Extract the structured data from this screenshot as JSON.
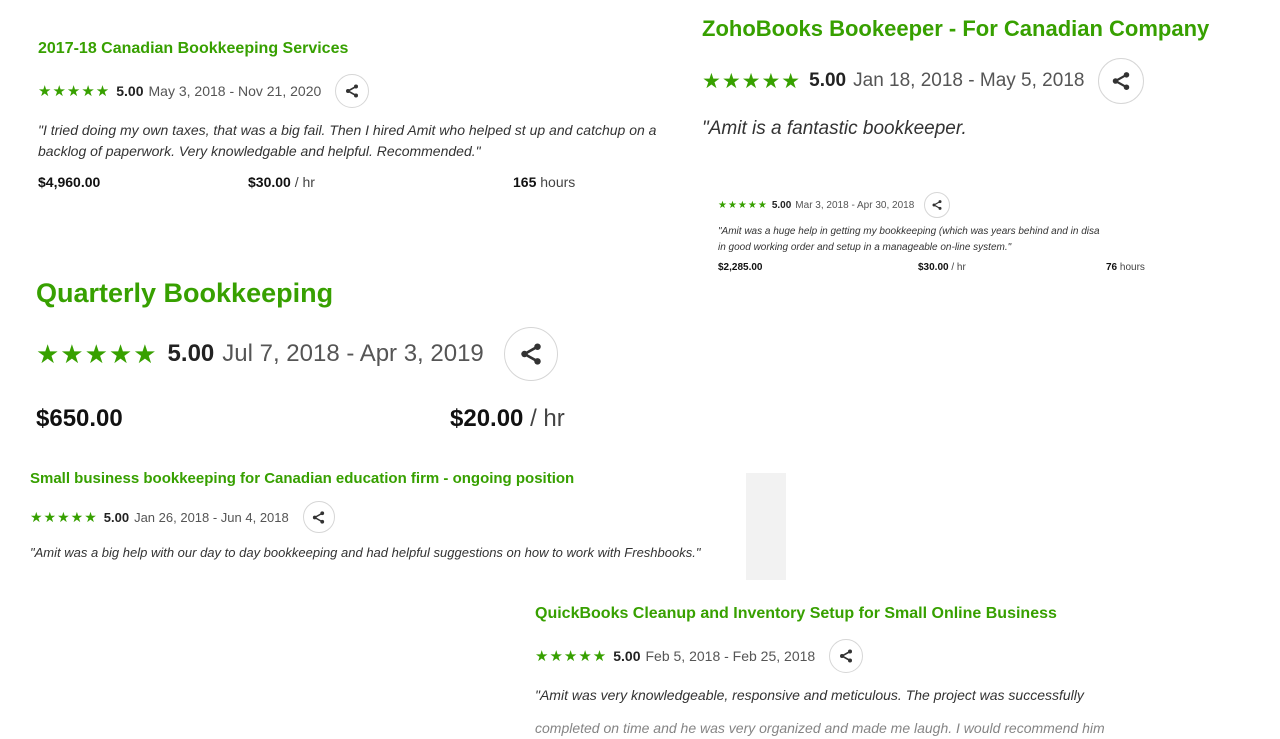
{
  "cards": [
    {
      "title": "2017-18 Canadian Bookkeeping Services",
      "stars": "★★★★★",
      "score": "5.00",
      "dates": "May 3, 2018 - Nov 21, 2020",
      "quote": "\"I tried doing my own taxes, that was a big fail. Then I hired Amit who helped st up and catchup on a backlog of paperwork. Very knowledgable and helpful. Recommended.\"",
      "total": "$4,960.00",
      "rate": "$30.00",
      "rate_unit": "/ hr",
      "hours": "165",
      "hours_unit": "hours"
    },
    {
      "title": "ZohoBooks Bookeeper - For Canadian Company",
      "stars": "★★★★★",
      "score": "5.00",
      "dates": "Jan 18, 2018 - May 5, 2018",
      "quote": "\"Amit is a fantastic bookkeeper."
    },
    {
      "stars": "★★★★★",
      "score": "5.00",
      "dates": "Mar 3, 2018 - Apr 30, 2018",
      "quote_line1": "\"Amit was a huge help in getting my bookkeeping (which was years behind and in disa",
      "quote_line2": "in good working order and setup in a manageable on-line system.\"",
      "total": "$2,285.00",
      "rate": "$30.00",
      "rate_unit": "/ hr",
      "hours": "76",
      "hours_unit": "hours"
    },
    {
      "title": "Quarterly Bookkeeping",
      "stars": "★★★★★",
      "score": "5.00",
      "dates": "Jul 7, 2018 - Apr 3, 2019",
      "total": "$650.00",
      "rate": "$20.00",
      "rate_unit": "/ hr"
    },
    {
      "title": "Small business bookkeeping for Canadian education firm - ongoing position",
      "stars": "★★★★★",
      "score": "5.00",
      "dates": "Jan 26, 2018 - Jun 4, 2018",
      "quote": "\"Amit was a big help with our day to day bookkeeping and had helpful suggestions on how to work with Freshbooks.\""
    },
    {
      "title": "QuickBooks Cleanup and Inventory Setup for Small Online Business",
      "stars": "★★★★★",
      "score": "5.00",
      "dates": "Feb 5, 2018 - Feb 25, 2018",
      "quote_line1": "\"Amit was very knowledgeable, responsive and meticulous. The project was successfully",
      "quote_line2": "completed on time and he was very organized and made me laugh. I would recommend him"
    }
  ],
  "icons": {
    "share": "share-icon"
  },
  "colors": {
    "accent": "#37a000"
  }
}
